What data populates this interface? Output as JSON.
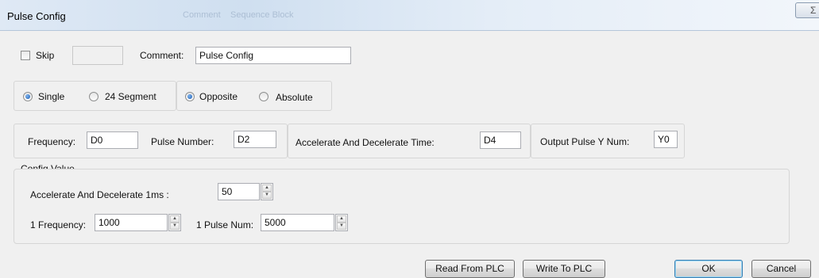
{
  "window": {
    "title": "Pulse Config",
    "ghost_title": "Comment",
    "ghost_subtitle": "Sequence Block",
    "close_glyph": "Σ"
  },
  "skip": {
    "label": "Skip",
    "checked": false,
    "value": ""
  },
  "comment": {
    "label": "Comment:",
    "value": "Pulse Config"
  },
  "mode_group": {
    "options": [
      "Single",
      "24 Segment"
    ],
    "selected": "Single"
  },
  "direction_group": {
    "options": [
      "Opposite",
      "Absolute"
    ],
    "selected": "Opposite"
  },
  "params": {
    "frequency": {
      "label": "Frequency:",
      "value": "D0"
    },
    "pulse_number": {
      "label": "Pulse Number:",
      "value": "D2"
    },
    "accel_time": {
      "label": "Accelerate And Decelerate Time:",
      "value": "D4"
    },
    "output_pulse": {
      "label": "Output Pulse Y Num:",
      "value": "Y0"
    }
  },
  "config_value": {
    "legend": "Config Value",
    "accel_1ms": {
      "label": "Accelerate And Decelerate 1ms :",
      "value": "50"
    },
    "frequency_1": {
      "label": "1 Frequency:",
      "value": "1000"
    },
    "pulse_num_1": {
      "label": "1 Pulse Num:",
      "value": "5000"
    }
  },
  "buttons": {
    "read": "Read From PLC",
    "write": "Write To PLC",
    "ok": "OK",
    "cancel": "Cancel"
  },
  "icons": {
    "spin_up": "▲",
    "spin_down": "▼"
  }
}
